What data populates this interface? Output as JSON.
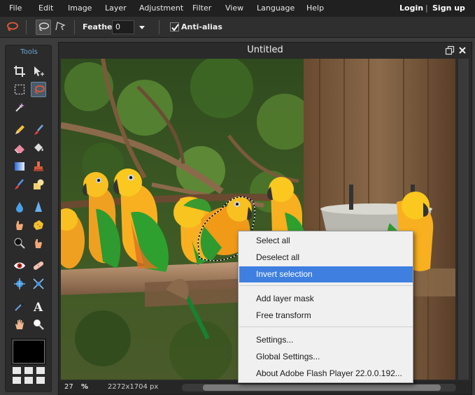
{
  "menubar": {
    "items": [
      "File",
      "Edit",
      "Image",
      "Layer",
      "Adjustment",
      "Filter",
      "View",
      "Language",
      "Help"
    ],
    "login": "Login",
    "separator": "|",
    "signup": "Sign up"
  },
  "options": {
    "feather_label": "Feather:",
    "feather_value": "0",
    "antialias_label": "Anti-alias",
    "antialias_checked": true
  },
  "tools": {
    "title": "Tools",
    "active_tool": "lasso",
    "primary_color": "#000000"
  },
  "document": {
    "title": "Untitled",
    "zoom": "27",
    "zoom_unit": "%",
    "dimensions": "2272x1704 px"
  },
  "context_menu": {
    "items": [
      "Select all",
      "Deselect all",
      "Invert selection",
      "Add layer mask",
      "Free transform",
      "Settings...",
      "Global Settings...",
      "About Adobe Flash Player 22.0.0.192..."
    ],
    "highlighted": "Invert selection",
    "highlight_color": "#3f7fe0"
  }
}
